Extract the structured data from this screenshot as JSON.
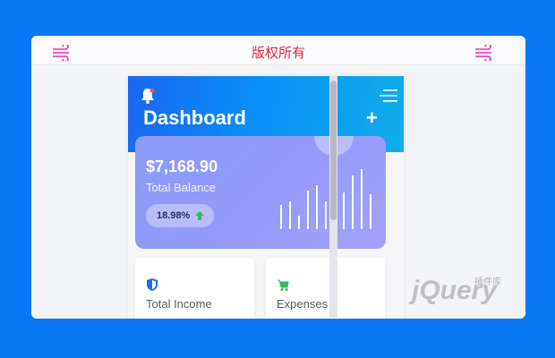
{
  "topbar": {
    "title": "版权所有",
    "left_icon": "wind-icon",
    "right_icon": "wind-icon",
    "accent_color": "#e0283b",
    "icon_color": "#e62cc6"
  },
  "app": {
    "title": "Dashboard",
    "bell_icon": "bell-icon",
    "menu_icon": "hamburger-menu-icon",
    "add_icon": "plus-icon",
    "add_label": "+"
  },
  "balance_card": {
    "amount": "$7,168.90",
    "label": "Total Balance",
    "change": "18.98%",
    "change_icon": "arrow-up-icon",
    "bar_values": [
      0.38,
      0.44,
      0.22,
      0.62,
      0.7,
      0.44,
      0.8,
      0.58,
      0.85,
      0.95,
      0.55
    ]
  },
  "mini_cards": [
    {
      "label": "Total Income",
      "icon": "shield-icon",
      "icon_color": "#1d6cf2"
    },
    {
      "label": "Expenses",
      "icon": "cart-icon",
      "icon_color": "#2ebd59"
    }
  ],
  "watermark": {
    "text": "jQuery",
    "sub": "插件库"
  }
}
